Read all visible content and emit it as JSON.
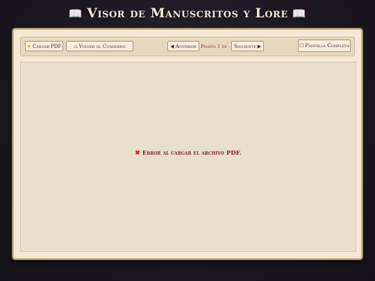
{
  "header": {
    "title": "Visor de Manuscritos y Lore",
    "left_icon": "open-book-icon",
    "right_icon": "open-book-icon"
  },
  "toolbar": {
    "load_pdf": {
      "icon": "star-icon",
      "label": "Cargar PDF"
    },
    "back_to_notebook": {
      "icon": "house-icon",
      "label": "Volver al Cuaderno"
    },
    "previous": {
      "icon": "triangle-left-icon",
      "label": "Anterior"
    },
    "page_info": "Página 1 de -",
    "next": {
      "icon": "triangle-right-icon",
      "label": "Siguiente"
    },
    "fullscreen": {
      "icon": "square-icon",
      "label": "Pantalla Completa"
    }
  },
  "viewer": {
    "error_icon": "x-mark-icon",
    "error_message": "Error al cargar el archivo PDF."
  },
  "colors": {
    "background": "#1c1822",
    "panel": "#f3e9d6",
    "toolbar": "#e6d8bd",
    "accent_red": "#8b2a1e",
    "error_red": "#8b1c1c"
  }
}
